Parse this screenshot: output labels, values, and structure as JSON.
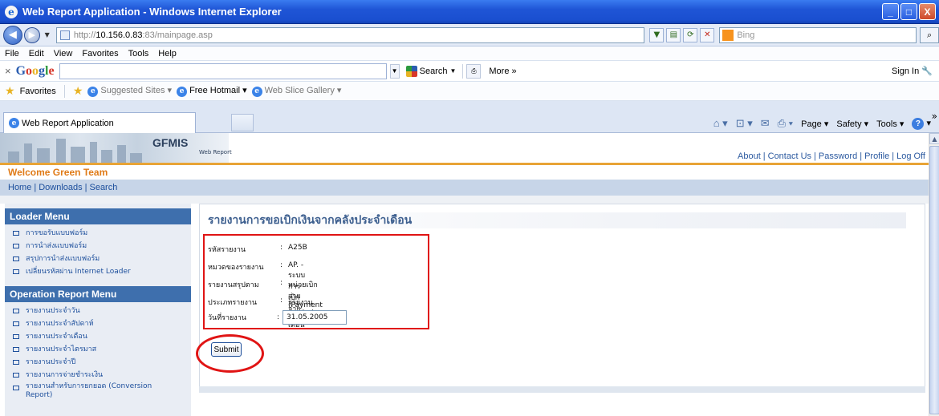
{
  "window": {
    "title": "Web Report Application - Windows Internet Explorer",
    "buttons": {
      "minimize": "_",
      "restore": "□",
      "close": "X"
    }
  },
  "address": {
    "url_prefix": "http://",
    "url_host": "10.156.0.83",
    "url_path": ":83/mainpage.asp",
    "search_placeholder": "Bing"
  },
  "menubar": [
    "File",
    "Edit",
    "View",
    "Favorites",
    "Tools",
    "Help"
  ],
  "google_toolbar": {
    "close": "×",
    "logo": [
      "G",
      "o",
      "o",
      "g",
      "l",
      "e"
    ],
    "search_label": "Search",
    "more_label": "More »",
    "sign_in": "Sign In"
  },
  "favorites_bar": {
    "favorites": "Favorites",
    "items": [
      "Suggested Sites",
      "Free Hotmail",
      "Web Slice Gallery"
    ]
  },
  "tab": {
    "label": "Web Report Application",
    "commands": [
      "Page",
      "Safety",
      "Tools"
    ]
  },
  "site": {
    "brand": "GFMIS",
    "brand_sub": "Web Report",
    "top_links": [
      "About",
      "Contact Us",
      "Password",
      "Profile",
      "Log Off"
    ],
    "welcome": "Welcome Green Team",
    "nav": [
      "Home",
      "Downloads",
      "Search"
    ]
  },
  "sidebar": {
    "loader_title": "Loader Menu",
    "loader_items": [
      "การขอรับแบบฟอร์ม",
      "การนำส่งแบบฟอร์ม",
      "สรุปการนำส่งแบบฟอร์ม",
      "เปลี่ยนรหัสผ่าน Internet Loader"
    ],
    "operation_title": "Operation Report Menu",
    "operation_items": [
      "รายงานประจำวัน",
      "รายงานประจำสัปดาห์",
      "รายงานประจำเดือน",
      "รายงานประจำไตรมาส",
      "รายงานประจำปี",
      "รายงานการจ่ายชำระเงิน",
      "รายงานสำหรับการยกยอด (Conversion Report)"
    ]
  },
  "report": {
    "title": "รายงานการขอเบิกเงินจากคลังประจำเดือน",
    "rows": [
      {
        "label": "รหัสรายงาน",
        "value": "A25B"
      },
      {
        "label": "หมวดของรายงาน",
        "value": "AP. - ระบบการเบิกจ่ายเงิน"
      },
      {
        "label": "รายงานสรุปตาม",
        "value": "หน่วยเบิกจ่าย (Payment center)"
      },
      {
        "label": "ประเภทรายงาน",
        "value": "รายงานประจำเดือน"
      }
    ],
    "date_label": "วันที่รายงาน",
    "date_value": "31.05.2005",
    "colon": ":",
    "submit_label": "Submit"
  }
}
